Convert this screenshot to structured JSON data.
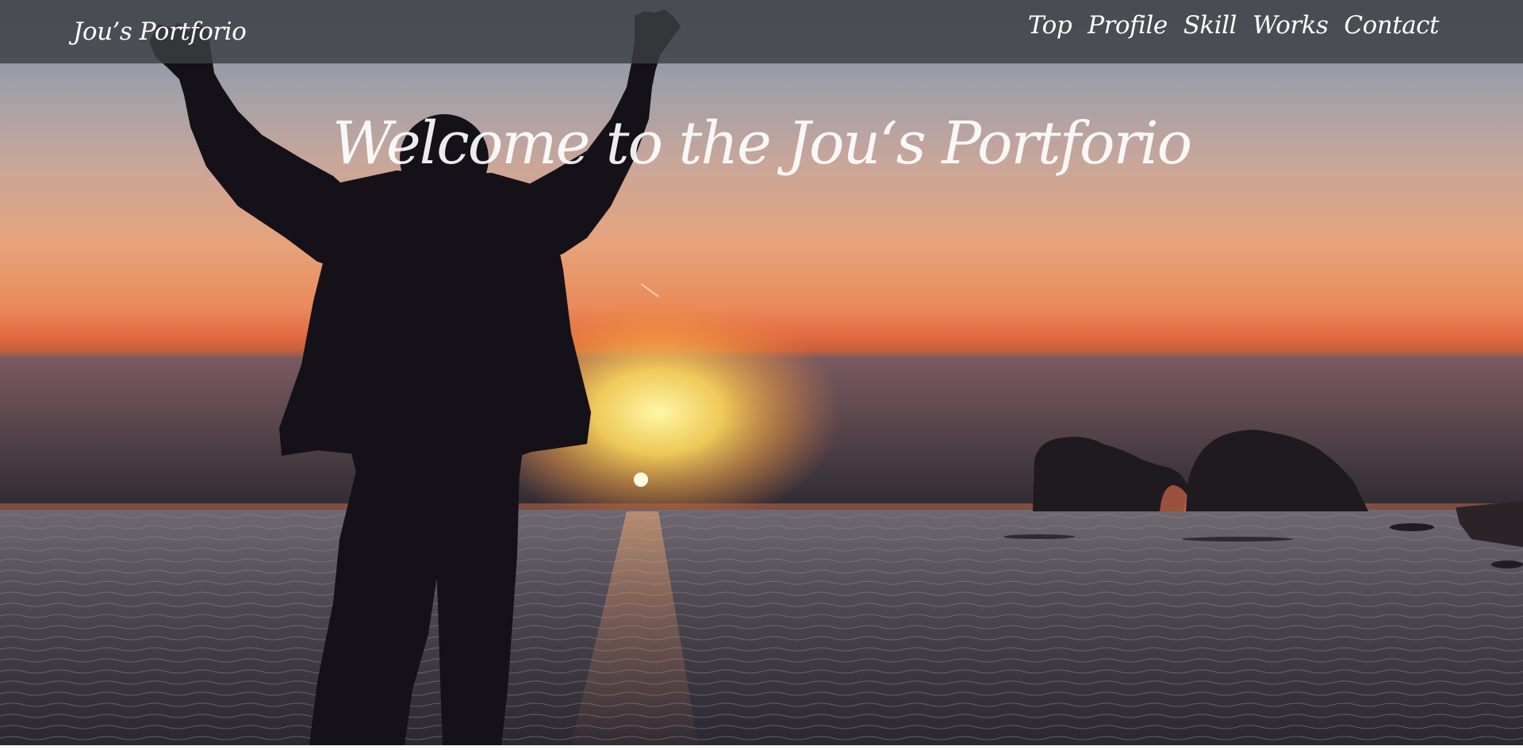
{
  "header": {
    "brand": "Jou’s Portforio",
    "nav": [
      {
        "label": "Top"
      },
      {
        "label": "Profile"
      },
      {
        "label": "Skill"
      },
      {
        "label": "Works"
      },
      {
        "label": "Contact"
      }
    ]
  },
  "hero": {
    "title": "Welcome to the Jou‘s Portforio",
    "image": {
      "subject": "person-silhouette-arms-raised",
      "scene": "sunset-over-sea-with-rock-arch-island"
    }
  },
  "colors": {
    "navbar_bg": "#3c3e42",
    "text": "#ffffff",
    "sky_top": "#8e96a6",
    "sky_mid": "#e8a878",
    "sky_horizon": "#e56a3c",
    "sun": "#ffe066",
    "sea": "#4a4650",
    "silhouette": "#15111a"
  }
}
